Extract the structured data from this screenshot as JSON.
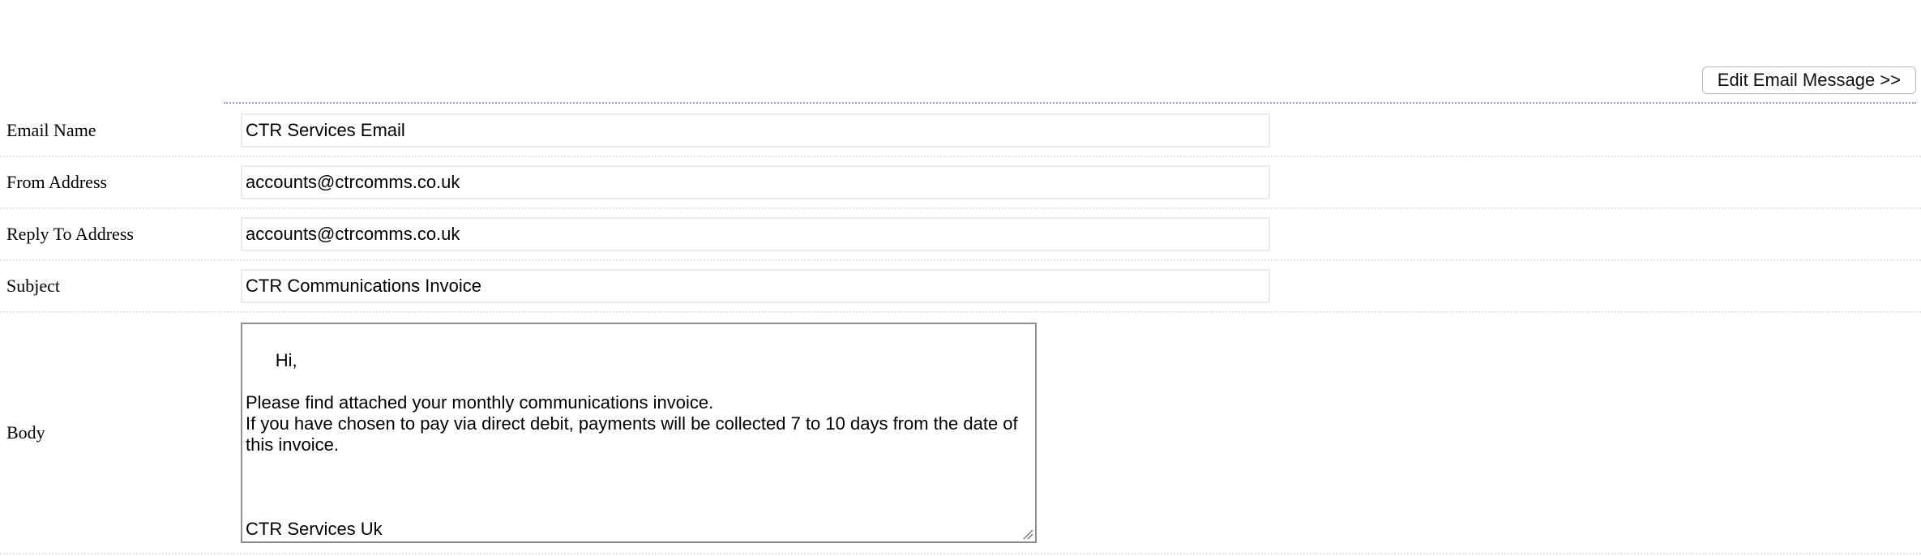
{
  "toolbar": {
    "edit_button_label": "Edit Email Message >>"
  },
  "form": {
    "email_name": {
      "label": "Email Name",
      "value": "CTR Services Email"
    },
    "from_address": {
      "label": "From Address",
      "value": "accounts@ctrcomms.co.uk"
    },
    "reply_to": {
      "label": "Reply To Address",
      "value": "accounts@ctrcomms.co.uk"
    },
    "subject": {
      "label": "Subject",
      "value": "CTR Communications Invoice"
    },
    "body": {
      "label": "Body",
      "value": "Hi,\n\nPlease find attached your monthly communications invoice.\nIf you have chosen to pay via direct debit, payments will be collected 7 to 10 days from the date of this invoice.\n\n\n\nCTR Services Uk"
    }
  },
  "icons": {
    "resize_grip": "resize-grip-icon"
  }
}
